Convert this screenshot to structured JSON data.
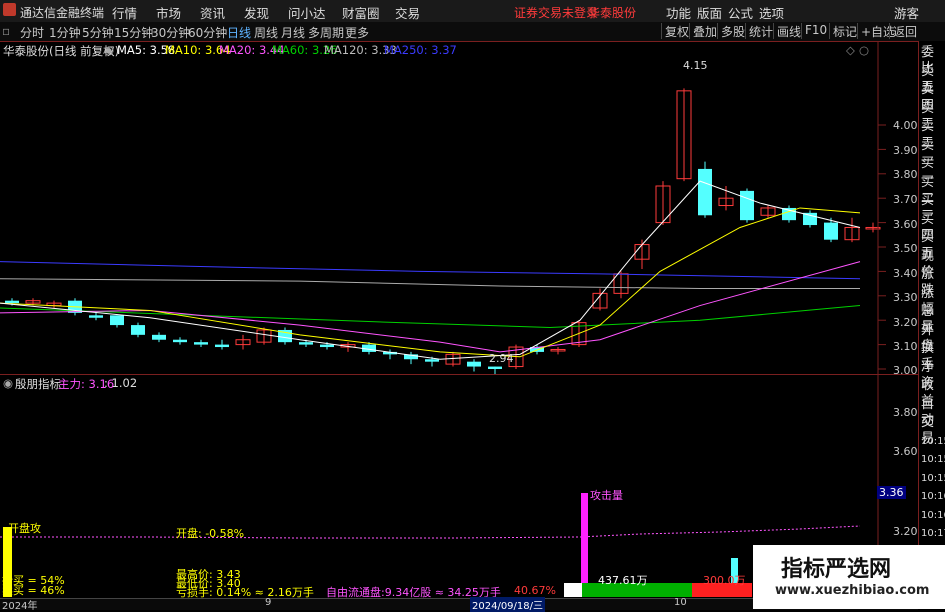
{
  "titlebar": {
    "app": "通达信金融终端",
    "menus": [
      "行情",
      "市场",
      "资讯",
      "发现",
      "问小达",
      "财富圈",
      "交易"
    ],
    "alert": "证券交易未登录",
    "stock": "华泰股份",
    "right": [
      "功能",
      "版面",
      "公式",
      "选项"
    ],
    "user": "游客",
    "r_icon": "R"
  },
  "toolbar": {
    "periods": [
      "分时",
      "1分钟",
      "5分钟",
      "15分钟",
      "30分钟",
      "60分钟",
      "日线",
      "周线",
      "月线",
      "多周期",
      "更多"
    ],
    "active": "日线",
    "right_buttons": [
      "复权",
      "叠加",
      "多股",
      "统计",
      "画线",
      "F10",
      "标记",
      "+自选",
      "返回"
    ]
  },
  "legend": {
    "name": "华泰股份(日线 前复权)",
    "ma5": "MA5: 3.58",
    "ma10": "MA10: 3.64",
    "ma20": "MA20: 3.44",
    "ma60": "MA60: 3.26",
    "ma120": "MA120: 3.33",
    "ma250": "MA250: 3.37"
  },
  "price_axis": [
    "4.00",
    "3.90",
    "3.80",
    "3.70",
    "3.60",
    "3.50",
    "3.40",
    "3.30",
    "3.20",
    "3.10",
    "3.00"
  ],
  "annotations": {
    "high": "4.15",
    "low": "2.94"
  },
  "sub": {
    "name": "殷朋指标",
    "main_label": "主力: 3.16",
    "ratio": ": 1.02",
    "axis": [
      "3.80",
      "3.60",
      "3.36",
      "3.20"
    ],
    "attack": "攻击量",
    "open_attack": "开盘攻",
    "open_pct": "开盘: -0.58%",
    "buy1": "抄买 = 54%",
    "buy2": "卖买 = 46%",
    "high": "最高价: 3.43",
    "low": "最低价: 3.40",
    "turnover": "亏损手: 0.14% ≈ 2.16万手",
    "free_float": "自由流通盘:9.34亿股 ≈ 34.25万手",
    "pct": "40.67%",
    "vol": "437.61万",
    "vol2": "300.0万"
  },
  "sidebar": {
    "items": [
      "委比",
      "卖五",
      "卖四",
      "卖三",
      "卖二",
      "卖一",
      "买一",
      "买二",
      "买三",
      "买四",
      "买五",
      "现价",
      "涨跌",
      "涨幅",
      "总量",
      "外盘",
      "换手",
      "净资",
      "收益",
      "自动",
      "交易",
      "10:15",
      "10:15",
      "10:15",
      "10:16",
      "10:16",
      "10:17",
      "10:17",
      "10:18"
    ]
  },
  "statusbar": {
    "year": "2024年",
    "m9": "9",
    "date": "2024/09/18/三",
    "m10": "10"
  },
  "colors": {
    "up": "#ff3b3b",
    "down": "#54ffff",
    "ma5": "#ffffff",
    "ma10": "#ffff00",
    "ma20": "#ff55ff",
    "ma60": "#00d000",
    "ma120": "#aaaaaa",
    "ma250": "#3b3bff"
  },
  "watermark": {
    "title": "指标严选网",
    "url": "www.xuezhibiao.com"
  }
}
